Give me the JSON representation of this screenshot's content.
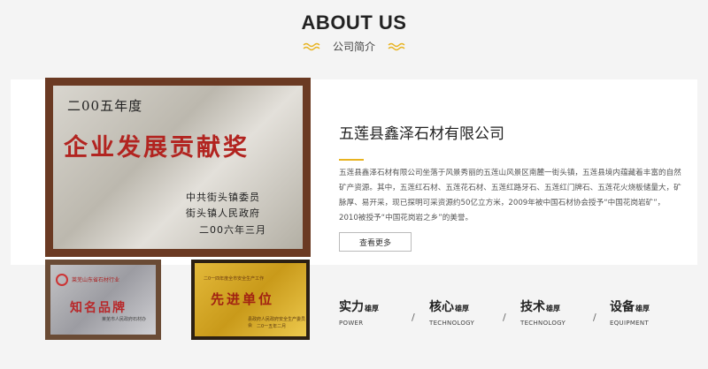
{
  "header": {
    "title": "ABOUT US",
    "subtitle": "公司简介"
  },
  "certificates": {
    "main": {
      "year_line": "二00五年度",
      "award": "企业发展贡献奖",
      "issuer1": "中共街头镇委员",
      "issuer2": "街头镇人民政府",
      "date": "二00六年三月"
    },
    "small1": {
      "header": "莱芜山东省石材行业",
      "award": "知名品牌",
      "footer": "莱芜市人民政府石材办"
    },
    "small2": {
      "header": "二0一四年度全市安全生产工作",
      "award": "先进单位",
      "footer1": "县政府人民政府安全生产委员会",
      "footer2": "二0一五年二月"
    }
  },
  "company": {
    "name": "五莲县鑫泽石材有限公司",
    "description": "五莲县鑫泽石材有限公司坐落于风景秀丽的五莲山风景区南麓一街头镇，五莲县境内蕴藏着丰富的自然矿产资源。其中，五莲红石材、五莲花石材、五莲红路牙石、五莲红门牌石、五莲花火烧板储量大，矿脉厚、易开采，现已探明可采资源约50亿立方米，2009年被中国石材协会授予“中国花岗岩矿”，2010被授予“中国花岗岩之乡”的美誉。",
    "more_label": "查看更多"
  },
  "features": [
    {
      "title": "实力",
      "suffix": "雄厚",
      "en": "POWER"
    },
    {
      "title": "核心",
      "suffix": "雄厚",
      "en": "TECHNOLOGY"
    },
    {
      "title": "技术",
      "suffix": "雄厚",
      "en": "TECHNOLOGY"
    },
    {
      "title": "设备",
      "suffix": "雄厚",
      "en": "EQUIPMENT"
    }
  ],
  "separator": "/",
  "colors": {
    "accent": "#e8b320",
    "award_red": "#b22420"
  }
}
